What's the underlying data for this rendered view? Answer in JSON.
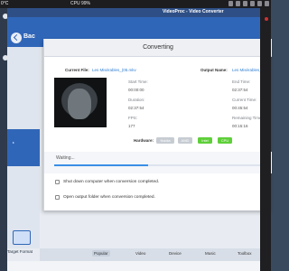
{
  "menubar": {
    "temperature": "0°C",
    "cpu": "CPU 99%"
  },
  "app": {
    "window_title": "VideoProc - Video Converter",
    "back_label": "Bac",
    "target_format_label": "Target Format",
    "bottom_tabs": [
      "Popular",
      "Video",
      "Device",
      "Music",
      "Toolbox"
    ]
  },
  "dialog": {
    "title": "Converting",
    "current_file_label": "Current File:",
    "current_file": "Les Misérables_(05.mkv",
    "output_name_label": "Output Name:",
    "output_name": "Les Misérables_(05.",
    "start_time_label": "Start Time:",
    "start_time": "00:00:00",
    "end_time_label": "End Time:",
    "end_time": "02:37:54",
    "duration_label": "Duration:",
    "duration": "02:37:54",
    "current_time_label": "Current Time:",
    "current_time": "00:45:54",
    "fps_label": "FPS:",
    "fps": "177",
    "remaining_label": "Remaining Time:",
    "remaining": "00:15:16",
    "hardware_label": "Hardware:",
    "hardware": [
      {
        "name": "Nvidia",
        "active": false
      },
      {
        "name": "AMD",
        "active": false
      },
      {
        "name": "Intel",
        "active": true
      },
      {
        "name": "CPU",
        "active": true
      }
    ],
    "status_text": "Waiting...",
    "progress_fraction": 0.45,
    "shutdown_option": "Shut down computer when conversion completed.",
    "shutdown_checked": false,
    "open_folder_option": "Open output folder when conversion completed.",
    "open_folder_checked": false
  },
  "colors": {
    "accent": "#3066b8",
    "progress": "#3a8ee6",
    "hw_active": "#5fcf3a",
    "hw_inactive": "#c7ccd3"
  }
}
